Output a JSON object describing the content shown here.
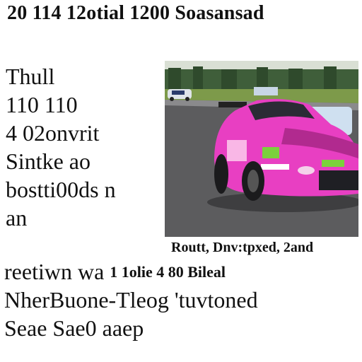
{
  "headline": "20 114  12otial 1200 Soasansad",
  "left_column": [
    "Thull",
    "110  110",
    "4 02onvrit",
    "Sintke ao",
    "bostti00ds  n",
    "an"
  ],
  "photo": {
    "subject": "pink race car",
    "colors": {
      "body": "#e83fc2",
      "track": "#5c5c5e",
      "grass": "#7d9a4a",
      "trees": "#3f5e3a"
    }
  },
  "caption": "Routt, Dnv:tpxed, 2and",
  "wide_lines": {
    "line1_left": "reetiwn wa",
    "line1_right": "1 1olie 4 80 Bileal",
    "line2": "NherBuone-Tleog 'tuvtoned",
    "line3": "Seae  Sae0  aaep"
  }
}
